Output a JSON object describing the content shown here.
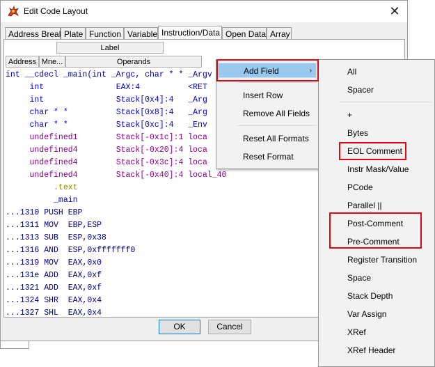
{
  "window": {
    "title": "Edit Code Layout",
    "close_glyph": "✕"
  },
  "tabs": [
    {
      "label": "Address Break"
    },
    {
      "label": "Plate"
    },
    {
      "label": "Function"
    },
    {
      "label": "Variable"
    },
    {
      "label": "Instruction/Data",
      "active": true
    },
    {
      "label": "Open Data"
    },
    {
      "label": "Array"
    }
  ],
  "headers": {
    "label": "Label",
    "address": "Address",
    "mnemonic": "Mne...",
    "operands": "Operands"
  },
  "listing": [
    {
      "text": "int __cdecl _main(int _Argc, char * * _Argv",
      "color": "#0000aa"
    },
    {
      "text": "     int               EAX:4          <RET",
      "color": "#0000cc"
    },
    {
      "text": "     int               Stack[0x4]:4   _Arg",
      "color": "#0000cc"
    },
    {
      "text": "     char * *          Stack[0x8]:4   _Arg",
      "color": "#0000cc"
    },
    {
      "text": "     char * *          Stack[0xc]:4   _Env",
      "color": "#0000cc"
    },
    {
      "text": "     undefined1        Stack[-0x1c]:1 loca",
      "color": "#8b008b"
    },
    {
      "text": "     undefined4        Stack[-0x20]:4 loca",
      "color": "#8b008b"
    },
    {
      "text": "     undefined4        Stack[-0x3c]:4 loca",
      "color": "#8b008b"
    },
    {
      "text": "     undefined4        Stack[-0x40]:4 local_40",
      "color": "#8b008b"
    },
    {
      "text": "          .text",
      "color": "#8b8b00"
    },
    {
      "text": "          _main",
      "color": "#0000cc"
    },
    {
      "text": "...1310 PUSH EBP",
      "color": "#000080"
    },
    {
      "text": "...1311 MOV  EBP,ESP",
      "color": "#000080"
    },
    {
      "text": "...1313 SUB  ESP,0x38",
      "color": "#000080"
    },
    {
      "text": "...1316 AND  ESP,0xfffffff0",
      "color": "#000080"
    },
    {
      "text": "...1319 MOV  EAX,0x0",
      "color": "#000080"
    },
    {
      "text": "...131e ADD  EAX,0xf",
      "color": "#000080"
    },
    {
      "text": "...1321 ADD  EAX,0xf",
      "color": "#000080"
    },
    {
      "text": "...1324 SHR  EAX,0x4",
      "color": "#000080"
    },
    {
      "text": "...1327 SHL  EAX,0x4",
      "color": "#000080"
    }
  ],
  "buttons": {
    "ok": "OK",
    "cancel": "Cancel"
  },
  "context_menu": {
    "items": [
      {
        "label": "Add Field",
        "highlighted": true,
        "submenu": true
      },
      {
        "label": "Insert Row"
      },
      {
        "label": "Remove All Fields"
      },
      {
        "label": "Reset All Formats"
      },
      {
        "label": "Reset Format"
      }
    ],
    "submenu_arrow": "›"
  },
  "add_field_submenu": [
    {
      "label": "All"
    },
    {
      "label": "Spacer"
    },
    {
      "label": "+"
    },
    {
      "label": "Bytes"
    },
    {
      "label": "EOL Comment"
    },
    {
      "label": "Instr Mask/Value"
    },
    {
      "label": "PCode"
    },
    {
      "label": "Parallel ||"
    },
    {
      "label": "Post-Comment"
    },
    {
      "label": "Pre-Comment"
    },
    {
      "label": "Register Transition"
    },
    {
      "label": "Space"
    },
    {
      "label": "Stack Depth"
    },
    {
      "label": "Var Assign"
    },
    {
      "label": "XRef"
    },
    {
      "label": "XRef Header"
    }
  ],
  "colors": {
    "highlight": "#99c9ef",
    "annotation_red": "#e30613",
    "menu_bg": "#f2f2f2"
  }
}
